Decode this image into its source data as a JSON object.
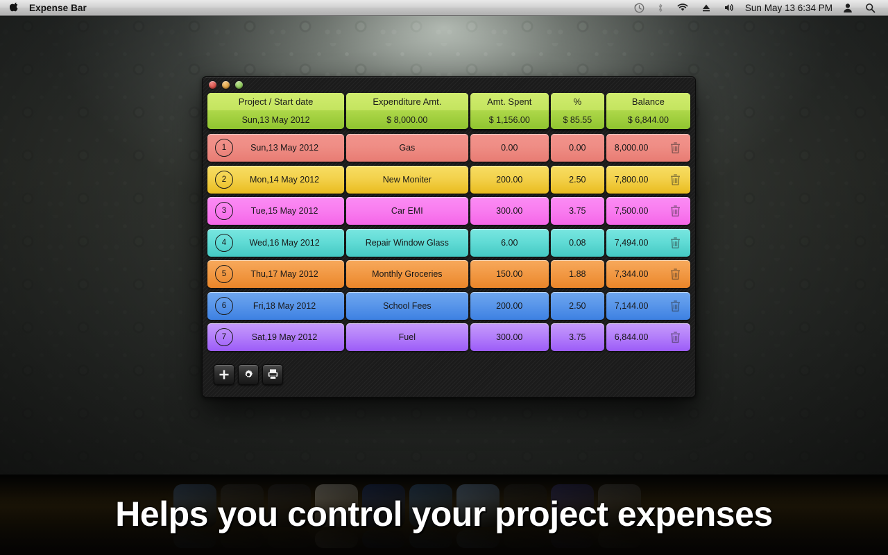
{
  "menubar": {
    "apple_icon": "apple-logo-icon",
    "app_title": "Expense Bar",
    "status_icons": [
      "time-machine-icon",
      "bluetooth-icon",
      "wifi-icon",
      "eject-icon",
      "volume-icon"
    ],
    "clock": "Sun May 13  6:34 PM",
    "user_icon": "user-account-icon",
    "spotlight_icon": "search-icon"
  },
  "window": {
    "traffic_lights": [
      "close-button",
      "minimize-button",
      "zoom-button"
    ],
    "header": {
      "columns": [
        {
          "title": "Project / Start date",
          "value": "Sun,13 May 2012"
        },
        {
          "title": "Expenditure Amt.",
          "value": "$ 8,000.00"
        },
        {
          "title": "Amt. Spent",
          "value": "$ 1,156.00"
        },
        {
          "title": "%",
          "value": "$ 85.55"
        },
        {
          "title": "Balance",
          "value": "$ 6,844.00"
        }
      ]
    },
    "rows": [
      {
        "num": "1",
        "date": "Sun,13 May 2012",
        "item": "Gas",
        "spent": "0.00",
        "pct": "0.00",
        "balance": "8,000.00",
        "color": "p-red",
        "hex": "#ef8d85"
      },
      {
        "num": "2",
        "date": "Mon,14 May 2012",
        "item": "New Moniter",
        "spent": "200.00",
        "pct": "2.50",
        "balance": "7,800.00",
        "color": "p-yellow",
        "hex": "#f3d24c"
      },
      {
        "num": "3",
        "date": "Tue,15 May 2012",
        "item": "Car EMI",
        "spent": "300.00",
        "pct": "3.75",
        "balance": "7,500.00",
        "color": "p-pink",
        "hex": "#f97ef0"
      },
      {
        "num": "4",
        "date": "Wed,16 May 2012",
        "item": "Repair Window Glass",
        "spent": "6.00",
        "pct": "0.08",
        "balance": "7,494.00",
        "color": "p-teal",
        "hex": "#62dcd6"
      },
      {
        "num": "5",
        "date": "Thu,17 May 2012",
        "item": "Monthly Groceries",
        "spent": "150.00",
        "pct": "1.88",
        "balance": "7,344.00",
        "color": "p-orange",
        "hex": "#f29a46"
      },
      {
        "num": "6",
        "date": "Fri,18 May 2012",
        "item": "School Fees",
        "spent": "200.00",
        "pct": "2.50",
        "balance": "7,144.00",
        "color": "p-blue",
        "hex": "#5a97ea"
      },
      {
        "num": "7",
        "date": "Sat,19 May 2012",
        "item": "Fuel",
        "spent": "300.00",
        "pct": "3.75",
        "balance": "6,844.00",
        "color": "p-purple",
        "hex": "#b581fa"
      }
    ],
    "row_delete_icon": "trash-icon",
    "toolbar": [
      {
        "icon": "add-icon",
        "name": "add-expense-button"
      },
      {
        "icon": "gear-icon",
        "name": "settings-button"
      },
      {
        "icon": "printer-icon",
        "name": "print-button"
      }
    ]
  },
  "caption": {
    "text": "Helps you control your project expenses"
  },
  "dock": {
    "icons": [
      {
        "name": "finder-icon",
        "hex": "#4a6f9e"
      },
      {
        "name": "dashboard-icon",
        "hex": "#3a3a3a"
      },
      {
        "name": "mission-control-icon",
        "hex": "#2f2f35"
      },
      {
        "name": "photos-icon",
        "hex": "#d8d4c8"
      },
      {
        "name": "itunes-icon",
        "hex": "#1f3f8a"
      },
      {
        "name": "safari-icon",
        "hex": "#3b6ea8"
      },
      {
        "name": "mail-icon",
        "hex": "#7ea7d8"
      },
      {
        "name": "ical-icon",
        "hex": "#2a2a2a"
      },
      {
        "name": "appstore-icon",
        "hex": "#3c3c8a"
      },
      {
        "name": "utilities-icon",
        "hex": "#5a5a5a"
      }
    ]
  },
  "colors": {
    "header_green_light": "#c4e45f",
    "header_green_dark": "#9ccc3a",
    "window_bg": "#1b1b1b",
    "menubar_bg": "#d2d2d2"
  }
}
